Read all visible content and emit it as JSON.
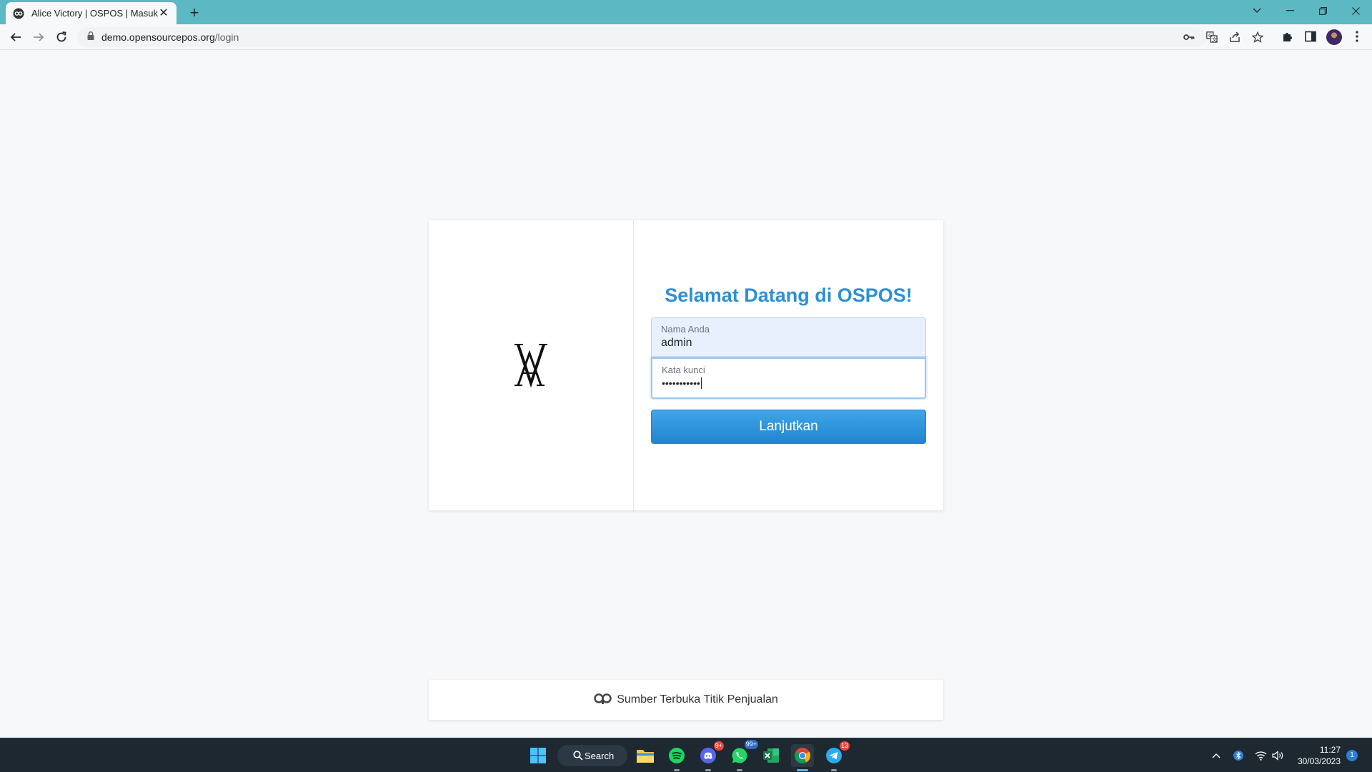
{
  "browser": {
    "tab_title": "Alice Victory | OSPOS | Masuk",
    "url_host": "demo.opensourcepos.org",
    "url_path": "/login"
  },
  "login": {
    "logo_text": "VA",
    "welcome": "Selamat Datang di OSPOS!",
    "username_label": "Nama Anda",
    "username_value": "admin",
    "password_label": "Kata kunci",
    "password_value": "•••••••••••",
    "continue_button": "Lanjutkan"
  },
  "footer": {
    "text": "Sumber Terbuka Titik Penjualan"
  },
  "taskbar": {
    "search_label": "Search",
    "discord_badge": "9+",
    "whatsapp_badge": "99+",
    "telegram_badge": "13",
    "time": "11:27",
    "date": "30/03/2023",
    "notification_count": "1"
  },
  "colors": {
    "tabstrip": "#5cb8c2",
    "accent": "#2d8fd5",
    "button": "#2284d0",
    "taskbar": "#1d2831"
  }
}
